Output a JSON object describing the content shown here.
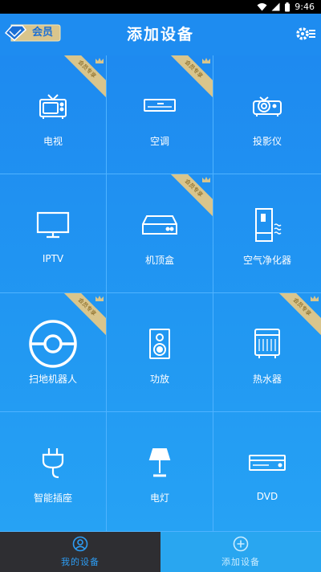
{
  "status": {
    "time": "9:46"
  },
  "header": {
    "vip_label": "会员",
    "title": "添加设备"
  },
  "ribbon_text": "会员专享",
  "devices": [
    {
      "label": "电视",
      "icon": "tv-icon",
      "vip": true
    },
    {
      "label": "空调",
      "icon": "air-conditioner-icon",
      "vip": true
    },
    {
      "label": "投影仪",
      "icon": "projector-icon",
      "vip": false
    },
    {
      "label": "IPTV",
      "icon": "monitor-icon",
      "vip": false
    },
    {
      "label": "机顶盒",
      "icon": "set-top-box-icon",
      "vip": true
    },
    {
      "label": "空气净化器",
      "icon": "air-purifier-icon",
      "vip": false
    },
    {
      "label": "扫地机器人",
      "icon": "robot-vacuum-icon",
      "vip": true
    },
    {
      "label": "功放",
      "icon": "speaker-icon",
      "vip": false
    },
    {
      "label": "热水器",
      "icon": "water-heater-icon",
      "vip": true
    },
    {
      "label": "智能插座",
      "icon": "plug-icon",
      "vip": false
    },
    {
      "label": "电灯",
      "icon": "lamp-icon",
      "vip": false
    },
    {
      "label": "DVD",
      "icon": "dvd-icon",
      "vip": false
    }
  ],
  "tabs": [
    {
      "label": "我的设备",
      "icon": "user-icon"
    },
    {
      "label": "添加设备",
      "icon": "add-circle-icon"
    }
  ],
  "colors": {
    "accent": "#1e8cf0",
    "gold": "#d9c58c",
    "tabbar_dark": "#2e2e32",
    "tab_active": "#29a6f0"
  }
}
